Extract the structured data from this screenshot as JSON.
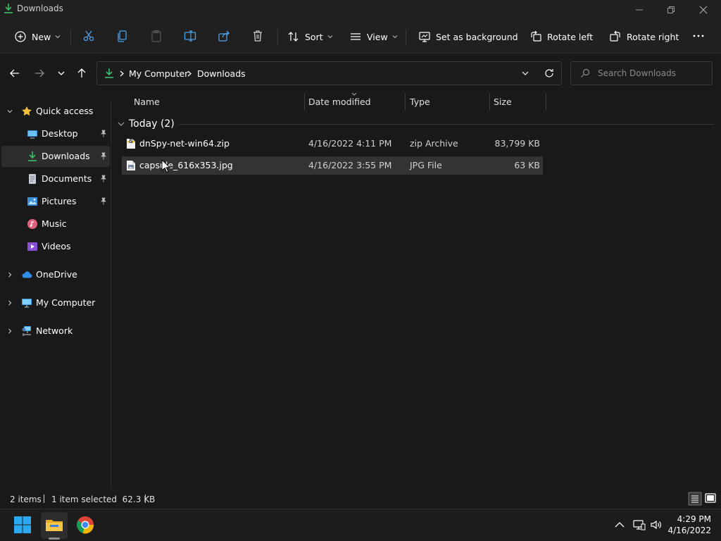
{
  "window": {
    "title": "Downloads"
  },
  "toolbar": {
    "new_label": "New",
    "sort_label": "Sort",
    "view_label": "View",
    "set_background_label": "Set as background",
    "rotate_left_label": "Rotate left",
    "rotate_right_label": "Rotate right"
  },
  "address": {
    "crumbs": [
      "My Computer",
      "Downloads"
    ],
    "search_placeholder": "Search Downloads"
  },
  "sidebar": {
    "items": [
      {
        "label": "Quick access",
        "icon": "star-icon"
      },
      {
        "label": "Desktop",
        "icon": "desktop-icon",
        "pinned": true
      },
      {
        "label": "Downloads",
        "icon": "download-icon",
        "pinned": true,
        "selected": true
      },
      {
        "label": "Documents",
        "icon": "documents-icon",
        "pinned": true
      },
      {
        "label": "Pictures",
        "icon": "pictures-icon",
        "pinned": true
      },
      {
        "label": "Music",
        "icon": "music-icon"
      },
      {
        "label": "Videos",
        "icon": "videos-icon"
      },
      {
        "label": "OneDrive",
        "icon": "cloud-icon"
      },
      {
        "label": "My Computer",
        "icon": "computer-icon"
      },
      {
        "label": "Network",
        "icon": "network-icon"
      }
    ]
  },
  "columns": [
    "Name",
    "Date modified",
    "Type",
    "Size"
  ],
  "group": {
    "label": "Today (2)"
  },
  "files": [
    {
      "name": "dnSpy-net-win64.zip",
      "date": "4/16/2022 4:11 PM",
      "type": "zip Archive",
      "size": "83,799 KB",
      "icon": "zip-file-icon"
    },
    {
      "name": "capsule_616x353.jpg",
      "date": "4/16/2022 3:55 PM",
      "type": "JPG File",
      "size": "63 KB",
      "icon": "image-file-icon",
      "selected": true
    }
  ],
  "status": {
    "item_count": "2 items",
    "selection": "1 item selected  62.3 KB"
  },
  "clock": {
    "time": "4:29 PM",
    "date": "4/16/2022"
  },
  "colors": {
    "accent": "#0078d4",
    "download_green": "#3dbd6a",
    "background": "#191919",
    "chrome": "#202020"
  }
}
